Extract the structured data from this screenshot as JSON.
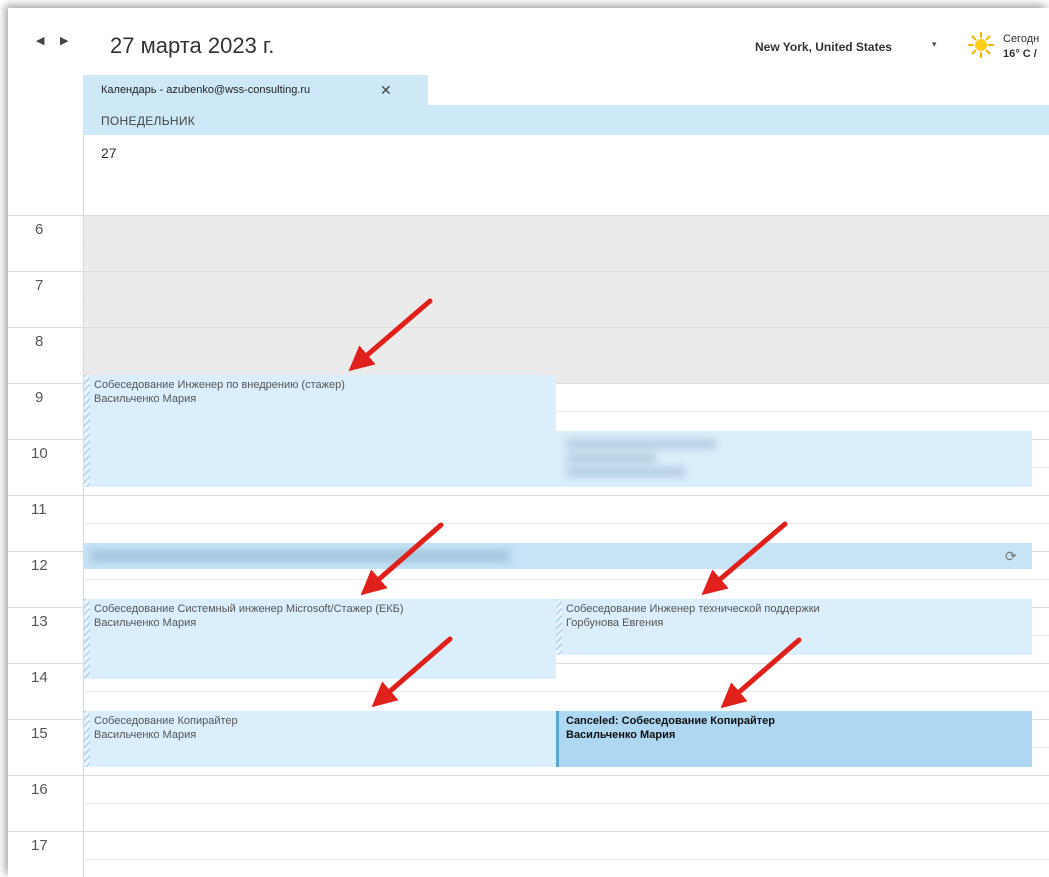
{
  "header": {
    "date_title": "27 марта 2023 г.",
    "location": "New York, United States",
    "weather_today": "Сегодн",
    "weather_temp": "16° C /"
  },
  "calendar_tab": {
    "label": "Календарь - azubenko@wss-consulting.ru",
    "close": "✕"
  },
  "day": {
    "name": "ПОНЕДЕЛЬНИК",
    "number": "27"
  },
  "hours": [
    "6",
    "7",
    "8",
    "9",
    "10",
    "11",
    "12",
    "13",
    "14",
    "15",
    "16",
    "17"
  ],
  "events": [
    {
      "title": "Собеседование Инженер по внедрению (стажер)",
      "person": "Васильченко Мария"
    },
    {
      "title": "Собеседование Системный инженер Microsoft/Стажер (ЕКБ)",
      "person": "Васильченко Мария"
    },
    {
      "title": "Собеседование Инженер технической поддержки",
      "person": "Горбунова Евгения"
    },
    {
      "title": "Собеседование Копирайтер",
      "person": "Васильченко Мария"
    },
    {
      "title": "Canceled: Собеседование Копирайтер",
      "person": "Васильченко Мария"
    }
  ],
  "colors": {
    "accent_light": "#cde8f7",
    "event_fill": "#dbeefb",
    "event_strong": "#aed7f2",
    "arrow_red": "#e0201b"
  },
  "icons": {
    "prev": "◀",
    "next": "▶",
    "location_dropdown": "▾",
    "recurring": "⟳"
  }
}
